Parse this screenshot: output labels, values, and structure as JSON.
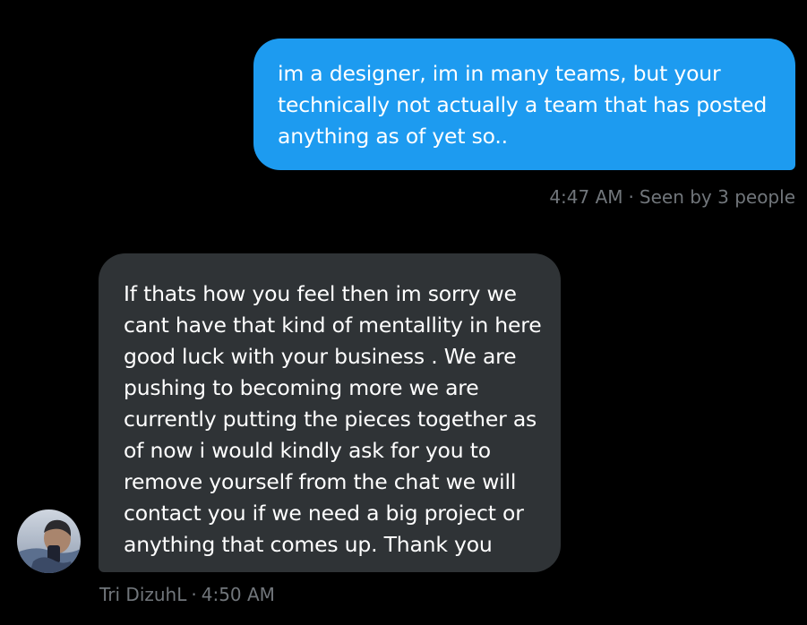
{
  "conversation": {
    "outgoing": {
      "text": "im a designer, im in many teams, but your technically not actually a team that has posted anything as of yet so..",
      "time": "4:47 AM",
      "separator": "·",
      "seen_status": "Seen by 3 people"
    },
    "incoming": {
      "text": "If thats how you feel then im sorry we cant have that kind of mentallity in here good luck with your business . We are pushing to becoming more we are currently putting the pieces together as of now i would kindly ask for you to remove yourself from the chat we will contact you if we need a big project or anything that comes up. Thank you",
      "sender": "Tri DizuhL",
      "separator": "·",
      "time": "4:50 AM"
    }
  },
  "colors": {
    "background": "#000000",
    "outgoing_bubble": "#1d9bf0",
    "incoming_bubble": "#2f3336",
    "meta_text": "#71767b"
  },
  "icons": {
    "avatar": "sender-avatar-photo"
  }
}
